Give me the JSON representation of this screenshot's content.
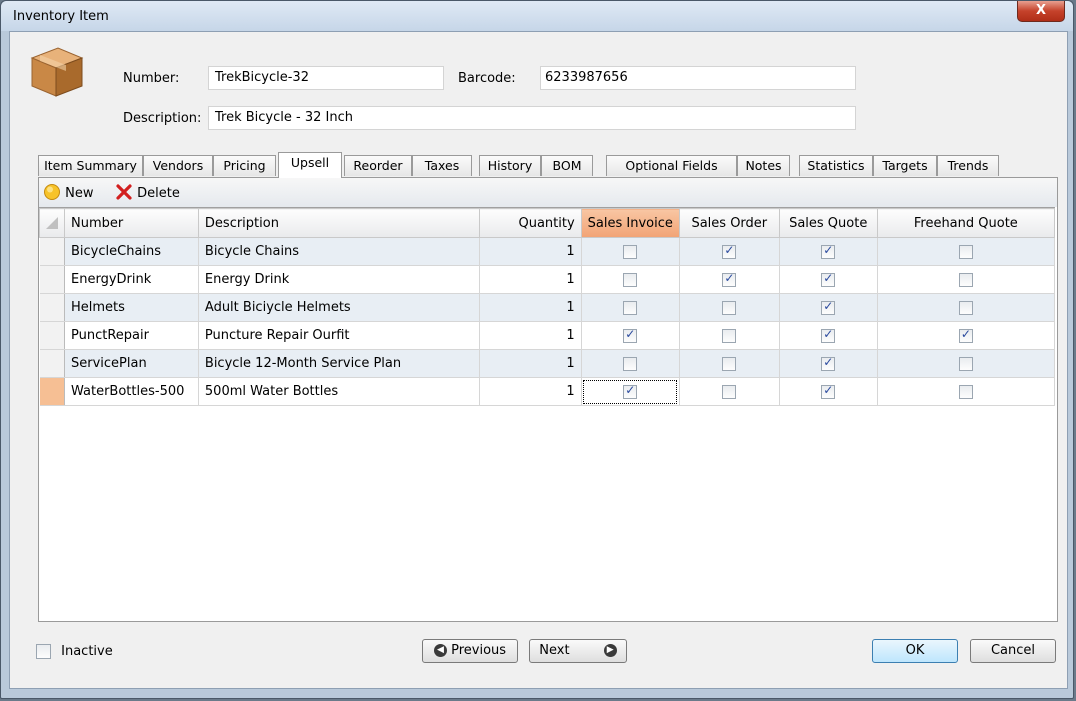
{
  "window": {
    "title": "Inventory Item",
    "close_label": "X"
  },
  "header": {
    "number_label": "Number:",
    "number_value": "TrekBicycle-32",
    "barcode_label": "Barcode:",
    "barcode_value": "6233987656",
    "description_label": "Description:",
    "description_value": "Trek Bicycle - 32 Inch"
  },
  "tabs": [
    "Item Summary",
    "Vendors",
    "Pricing",
    "Upsell",
    "Reorder",
    "Taxes",
    "History",
    "BOM",
    "Optional Fields",
    "Notes",
    "Statistics",
    "Targets",
    "Trends"
  ],
  "active_tab": "Upsell",
  "toolbar": {
    "new_label": "New",
    "delete_label": "Delete"
  },
  "grid": {
    "columns": [
      "Number",
      "Description",
      "Quantity",
      "Sales Invoice",
      "Sales Order",
      "Sales Quote",
      "Freehand Quote"
    ],
    "selected_column": "Sales Invoice",
    "rows": [
      {
        "number": "BicycleChains",
        "description": "Bicycle Chains",
        "quantity": "1",
        "sales_invoice": false,
        "sales_order": true,
        "sales_quote": true,
        "freehand_quote": false
      },
      {
        "number": "EnergyDrink",
        "description": "Energy Drink",
        "quantity": "1",
        "sales_invoice": false,
        "sales_order": true,
        "sales_quote": true,
        "freehand_quote": false
      },
      {
        "number": "Helmets",
        "description": "Adult Biciycle Helmets",
        "quantity": "1",
        "sales_invoice": false,
        "sales_order": false,
        "sales_quote": true,
        "freehand_quote": false
      },
      {
        "number": "PunctRepair",
        "description": "Puncture Repair Ourfit",
        "quantity": "1",
        "sales_invoice": true,
        "sales_order": false,
        "sales_quote": true,
        "freehand_quote": true
      },
      {
        "number": "ServicePlan",
        "description": "Bicycle 12-Month Service Plan",
        "quantity": "1",
        "sales_invoice": false,
        "sales_order": false,
        "sales_quote": true,
        "freehand_quote": false
      },
      {
        "number": "WaterBottles-500",
        "description": "500ml Water Bottles",
        "quantity": "1",
        "sales_invoice": true,
        "sales_order": false,
        "sales_quote": true,
        "freehand_quote": false
      }
    ],
    "current_row": 5
  },
  "footer": {
    "inactive_label": "Inactive",
    "inactive_checked": false,
    "previous_label": "Previous",
    "next_label": "Next",
    "ok_label": "OK",
    "cancel_label": "Cancel"
  },
  "colors": {
    "selected_header": "#f2a375",
    "current_row_header": "#f6bf94",
    "alt_row": "#e8eef4",
    "check": "#2a4a9e"
  },
  "icons": [
    "box-icon",
    "new-icon",
    "delete-icon",
    "previous-arrow-icon",
    "next-arrow-icon",
    "close-icon"
  ]
}
